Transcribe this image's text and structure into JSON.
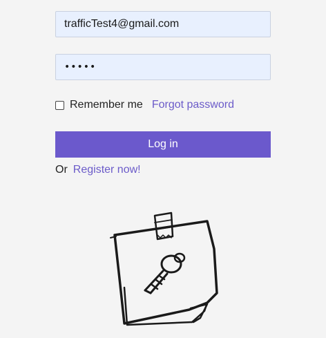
{
  "login_form": {
    "email_value": "trafficTest4@gmail.com",
    "password_value": "•••••",
    "remember_label": "Remember me",
    "forgot_label": "Forgot password",
    "login_label": "Log in",
    "or_text": "Or",
    "register_label": "Register now!"
  },
  "illustration": {
    "icon": "sticky-note-key-icon"
  },
  "colors": {
    "background": "#f4f4f4",
    "input_background": "#e8f0fe",
    "primary_button": "#6b59cc",
    "link": "#6b5bc9"
  }
}
